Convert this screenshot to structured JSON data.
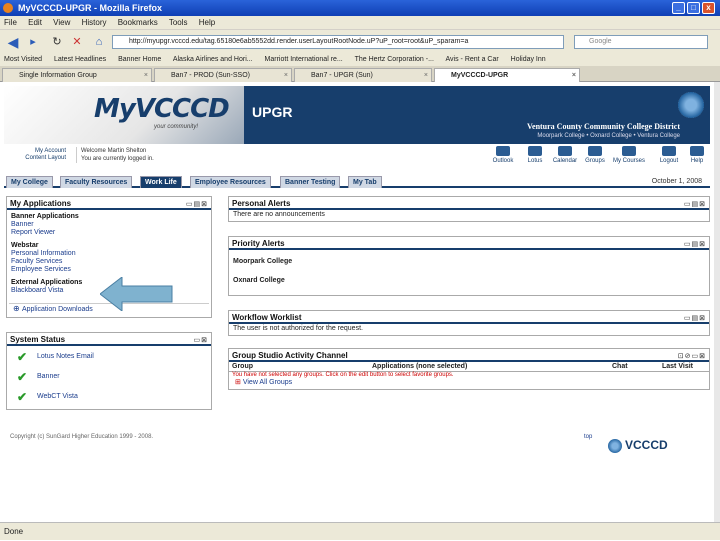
{
  "window": {
    "title": "MyVCCCD-UPGR - Mozilla Firefox",
    "minimize": "_",
    "maximize": "□",
    "close": "x"
  },
  "menu": [
    "File",
    "Edit",
    "View",
    "History",
    "Bookmarks",
    "Tools",
    "Help"
  ],
  "nav": {
    "url": "http://myupgr.vcccd.edu/tag.65180e6ab5552dd.render.userLayoutRootNode.uP?uP_root=root&uP_sparam=a",
    "search_placeholder": "Google"
  },
  "bookmarks": [
    "Most Visited",
    "Latest Headlines",
    "Banner Home",
    "Alaska Airlines and Hori...",
    "Marriott International re...",
    "The Hertz Corporation -...",
    "Avis - Rent a Car",
    "Holiday Inn"
  ],
  "browser_tabs": [
    {
      "label": "Single Information Group",
      "active": false
    },
    {
      "label": "Ban7 - PROD (Sun-SSO)",
      "active": false
    },
    {
      "label": "Ban7 - UPGR (Sun)",
      "active": false
    },
    {
      "label": "MyVCCCD-UPGR",
      "active": true
    }
  ],
  "banner": {
    "logo": "MyVCCCD",
    "logo_sub": "your community!",
    "env": "UPGR",
    "district": "Ventura County Community College District",
    "colleges": "Moorpark College • Oxnard College • Ventura College"
  },
  "userbar": {
    "my_account": "My Account",
    "content_layout": "Content Layout",
    "welcome": "Welcome Martin Shelton",
    "currently": "You are currently logged in."
  },
  "tools": [
    "Outlook",
    "Lotus",
    "Calendar",
    "Groups",
    "My Courses",
    "Logout",
    "Help"
  ],
  "tabs": [
    "My College",
    "Faculty Resources",
    "Work Life",
    "Employee Resources",
    "Banner Testing",
    "My Tab"
  ],
  "active_tab": "Work Life",
  "date": "October 1, 2008",
  "my_applications": {
    "title": "My Applications",
    "sections": [
      {
        "heading": "Banner Applications",
        "links": [
          "Banner",
          "Report Viewer"
        ]
      },
      {
        "heading": "Webstar",
        "links": [
          "Personal Information",
          "Faculty Services",
          "Employee Services"
        ]
      },
      {
        "heading": "External Applications",
        "links": [
          "Blackboard Vista"
        ]
      }
    ],
    "app_downloads": "Application Downloads"
  },
  "system_status": {
    "title": "System Status",
    "items": [
      "Lotus Notes Email",
      "Banner",
      "WebCT Vista"
    ]
  },
  "personal_alerts": {
    "title": "Personal Alerts",
    "text": "There are no announcements"
  },
  "priority_alerts": {
    "title": "Priority Alerts",
    "items": [
      "Moorpark College",
      "Oxnard College"
    ]
  },
  "workflow": {
    "title": "Workflow Worklist",
    "text": "The user is not authorized for the request."
  },
  "group_studio": {
    "title": "Group Studio Activity Channel",
    "columns": [
      "Group",
      "Applications (none selected)",
      "Chat",
      "Last Visit"
    ],
    "notice": "You have not selected any groups. Click on the edit button to select favorite groups.",
    "view_all": "View All Groups"
  },
  "footer": {
    "copyright": "Copyright (c) SunGard Higher Education 1999 - 2008.",
    "top": "top",
    "logo": "VCCCD"
  },
  "status": "Done",
  "colors": {
    "banner": "#173e6c",
    "titlebar": "#0f3fb4",
    "arrow": "#7fb2cf",
    "check": "#2a9a2a"
  }
}
